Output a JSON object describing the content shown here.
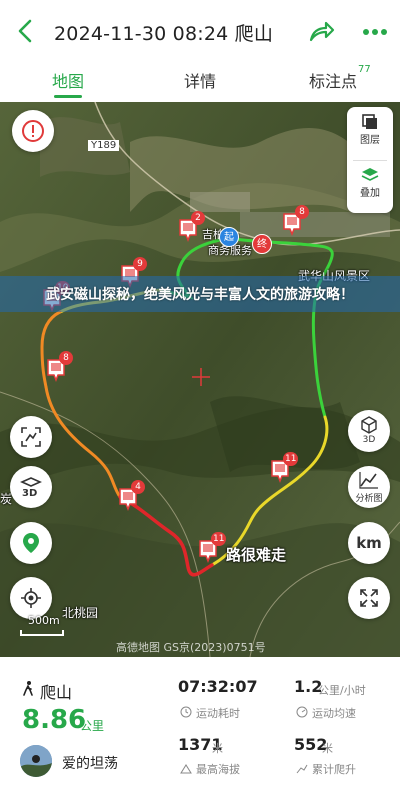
{
  "header": {
    "title": "2024-11-30 08:24 爬山",
    "back_icon": "chevron-left-icon",
    "share_icon": "share-arrow-icon",
    "more_icon": "more-dots-icon"
  },
  "tabs": [
    {
      "label": "地图",
      "active": true
    },
    {
      "label": "详情",
      "active": false
    },
    {
      "label": "标注点",
      "active": false,
      "badge": "77"
    }
  ],
  "map": {
    "layers": [
      {
        "label": "图层",
        "icon": "layers-icon"
      },
      {
        "label": "叠加",
        "icon": "overlay-icon"
      }
    ],
    "labels": {
      "road": "Y189",
      "service": "商务服务",
      "service_pre": "吉柏",
      "scenic": "武华山风景区",
      "village": "北桃园",
      "left_edge": "炭",
      "note": "路很难走"
    },
    "start_badge": "起",
    "end_badge": "终",
    "markers": [
      "2",
      "8",
      "9",
      "10",
      "8",
      "4",
      "11",
      "11"
    ],
    "scale": "500m",
    "watermark": "高德地图 GS京(2023)0751号",
    "banner": "武安磁山探秘，绝美风光与丰富人文的旅游攻略！",
    "side_buttons": {
      "view3d": "3D",
      "analysis": "分析图",
      "km": "km"
    },
    "colors": {
      "route_green": "#3bd23b",
      "route_yellow": "#e9d82a",
      "route_orange": "#f08a24",
      "route_red": "#e0262a",
      "accent": "#27a84a"
    }
  },
  "stats": {
    "activity": "爬山",
    "distance": "8.86",
    "distance_unit": "公里",
    "user": "爱的坦荡",
    "duration": "07:32:07",
    "duration_label": "运动耗时",
    "speed": "1.2",
    "speed_unit": "公里/小时",
    "speed_label": "运动均速",
    "max_alt": "1371",
    "max_alt_unit": "米",
    "max_alt_label": "最高海拔",
    "ascent": "552",
    "ascent_unit": "米",
    "ascent_label": "累计爬升"
  }
}
